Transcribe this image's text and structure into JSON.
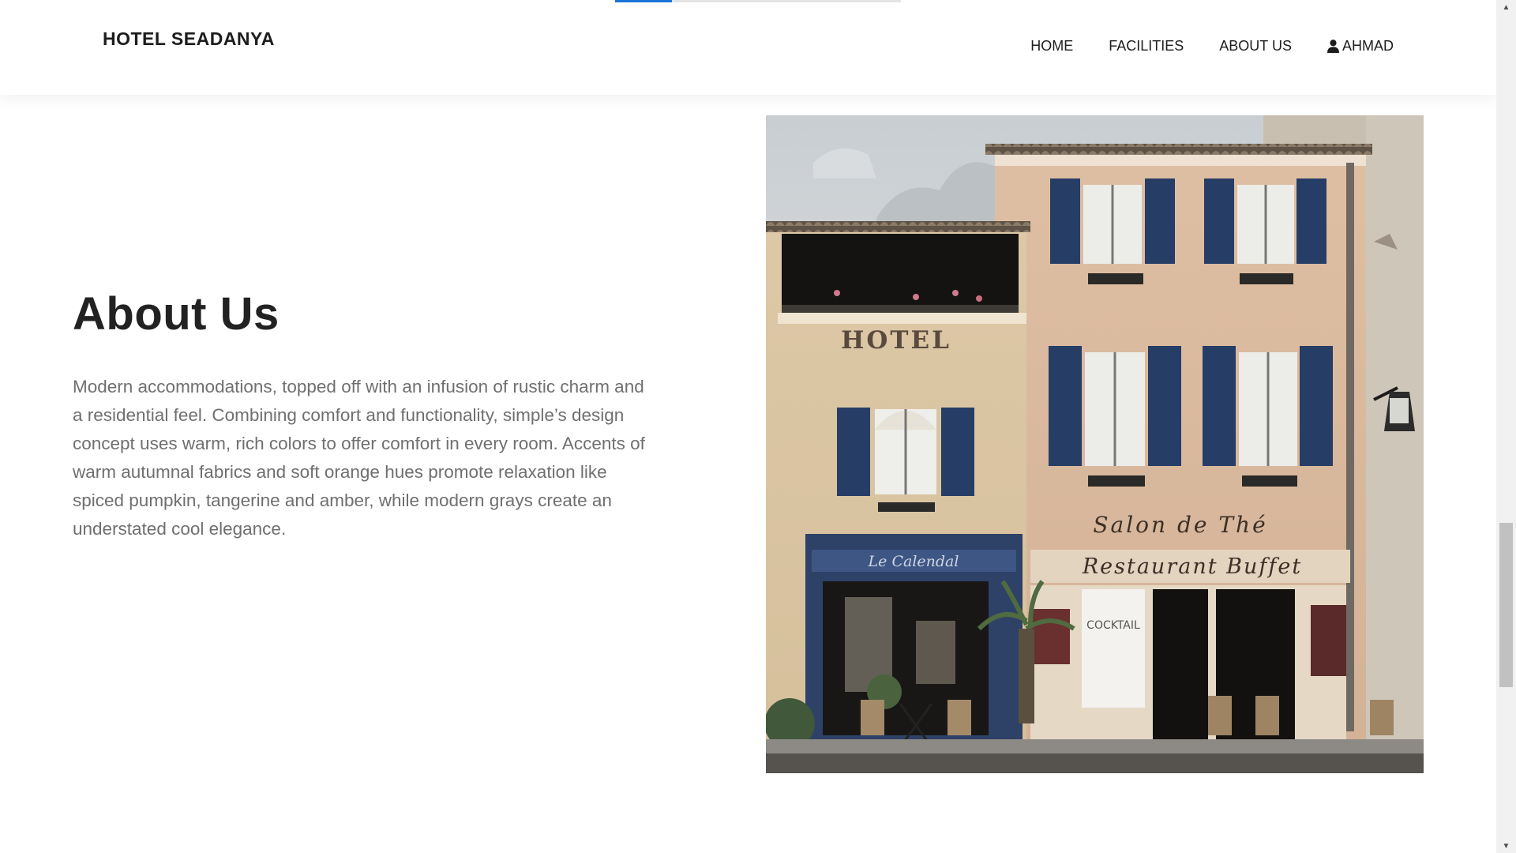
{
  "header": {
    "brand": "HOTEL SEADANYA",
    "nav": [
      {
        "label": "HOME"
      },
      {
        "label": "FACILITIES"
      },
      {
        "label": "ABOUT US"
      },
      {
        "label": "AHMAD",
        "icon": "user-icon"
      }
    ],
    "scroll_progress": 0.2
  },
  "about": {
    "title": "About Us",
    "body": "Modern accommodations, topped off with an infusion of rustic charm and a residential feel. Combining comfort and functionality, simple’s design concept uses warm, rich colors to offer comfort in every room. Accents of warm autumnal fabrics and soft orange hues promote relaxation like spiced pumpkin, tangerine and amber, while modern grays create an understated cool elegance."
  },
  "photo": {
    "signs": {
      "hotel": "HOTEL",
      "salon": "Salon de Thé",
      "restaurant": "Restaurant  Buffet",
      "calendal": "Le Calendal",
      "cocktail": "COCKTAIL"
    }
  },
  "colors": {
    "accent": "#1a73d9",
    "heading": "#222222",
    "body_text": "#6f6f6f",
    "shutter_blue": "#263d66"
  }
}
